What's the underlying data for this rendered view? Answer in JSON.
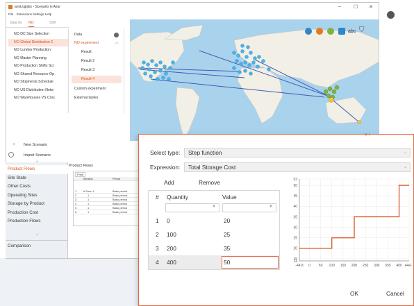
{
  "window": {
    "title": "anyLogistix - Scenario in Azur",
    "minimize": "–",
    "maximize": "☐",
    "close": "✕"
  },
  "menu": [
    "File",
    "Extensions",
    "Settings",
    "Help"
  ],
  "tabs": [
    {
      "label": "Data Gr",
      "active": false
    },
    {
      "label": "NO",
      "active": true
    },
    {
      "label": "SIM",
      "active": false
    }
  ],
  "scenarios": [
    {
      "label": "NO DC Size Selection",
      "selected": false
    },
    {
      "label": "NO Global Distribution E",
      "selected": true
    },
    {
      "label": "NO Lumber Production",
      "selected": false
    },
    {
      "label": "NO Master Planning",
      "selected": false
    },
    {
      "label": "NO Production Shifts Sci",
      "selected": false
    },
    {
      "label": "NO Shared Resource Op",
      "selected": false
    },
    {
      "label": "NO Shipments Schedule",
      "selected": false
    },
    {
      "label": "NO US Distribution Netw",
      "selected": false
    },
    {
      "label": "NO Warehouses VS Cros",
      "selected": false
    }
  ],
  "data_panel": [
    {
      "label": "Data",
      "kind": "item",
      "icon": "check-circle-icon"
    },
    {
      "label": "NO experiment",
      "kind": "expanded"
    },
    {
      "label": "Result",
      "kind": "sub"
    },
    {
      "label": "Result 2",
      "kind": "sub"
    },
    {
      "label": "Result 3",
      "kind": "sub"
    },
    {
      "label": "Result 4",
      "kind": "sub-selected"
    },
    {
      "label": "Custom experiment",
      "kind": "item"
    },
    {
      "label": "External tables",
      "kind": "item"
    }
  ],
  "scenario_actions": {
    "new_label": "New Scenario",
    "import_label": "Import Scenario"
  },
  "bottom_nav": {
    "items": [
      {
        "label": "Product Flows",
        "selected": true
      },
      {
        "label": "Site State",
        "selected": false
      },
      {
        "label": "Other Costs",
        "selected": false
      },
      {
        "label": "Operating Sites",
        "selected": false
      },
      {
        "label": "Storage by Product",
        "selected": false
      },
      {
        "label": "Production Cost",
        "selected": false
      },
      {
        "label": "Production Flows",
        "selected": false
      }
    ],
    "comparison_label": "Comparison"
  },
  "product_flows": {
    "title": "Product Flows",
    "tab": "From",
    "columns": [
      "Iteration",
      "Period"
    ],
    "rows": [
      {
        "n": "1",
        "a": "# Sum: 1",
        "b": "Basic period"
      },
      {
        "n": "2",
        "a": "1",
        "b": "Basic period"
      },
      {
        "n": "3",
        "a": "1",
        "b": "Basic period"
      },
      {
        "n": "4",
        "a": "1",
        "b": "Basic period"
      },
      {
        "n": "5",
        "a": "1",
        "b": "Basic period"
      },
      {
        "n": "6",
        "a": "1",
        "b": "Basic period"
      }
    ]
  },
  "map_tools": {
    "abc_label": "abc",
    "colors": [
      "#2f86c8",
      "#e07a1f",
      "#7cb342",
      "#2f86c8"
    ]
  },
  "dialog": {
    "select_type_label": "Select type:",
    "select_type_value": "Step function",
    "expression_label": "Expression:",
    "expression_value": "Total Storage Cost",
    "add_label": "Add",
    "remove_label": "Remove",
    "grid_headers": [
      "#",
      "Quantity",
      "Value"
    ],
    "rows": [
      {
        "n": "1",
        "quantity": "0",
        "value": "20"
      },
      {
        "n": "2",
        "quantity": "100",
        "value": "25"
      },
      {
        "n": "3",
        "quantity": "200",
        "value": "35"
      },
      {
        "n": "4",
        "quantity": "400",
        "value": "50"
      }
    ],
    "ok_label": "OK",
    "cancel_label": "Cancel"
  },
  "chart_data": {
    "type": "line",
    "title": "",
    "xlabel": "",
    "ylabel": "",
    "x": [
      -44.8,
      100,
      100,
      200,
      200,
      400,
      400,
      444.8
    ],
    "y": [
      20,
      20,
      25,
      25,
      35,
      35,
      50,
      50
    ],
    "xlim": [
      -44.8,
      444.8
    ],
    "ylim": [
      14,
      53
    ],
    "x_ticks": [
      "-44.8",
      "0",
      "50",
      "100",
      "150",
      "200",
      "250",
      "300",
      "350",
      "400",
      "444.8"
    ],
    "y_ticks": [
      "53",
      "50",
      "45",
      "40",
      "35",
      "30",
      "25",
      "20",
      "15",
      "14"
    ],
    "line_color": "#d9531e",
    "grid": true
  }
}
